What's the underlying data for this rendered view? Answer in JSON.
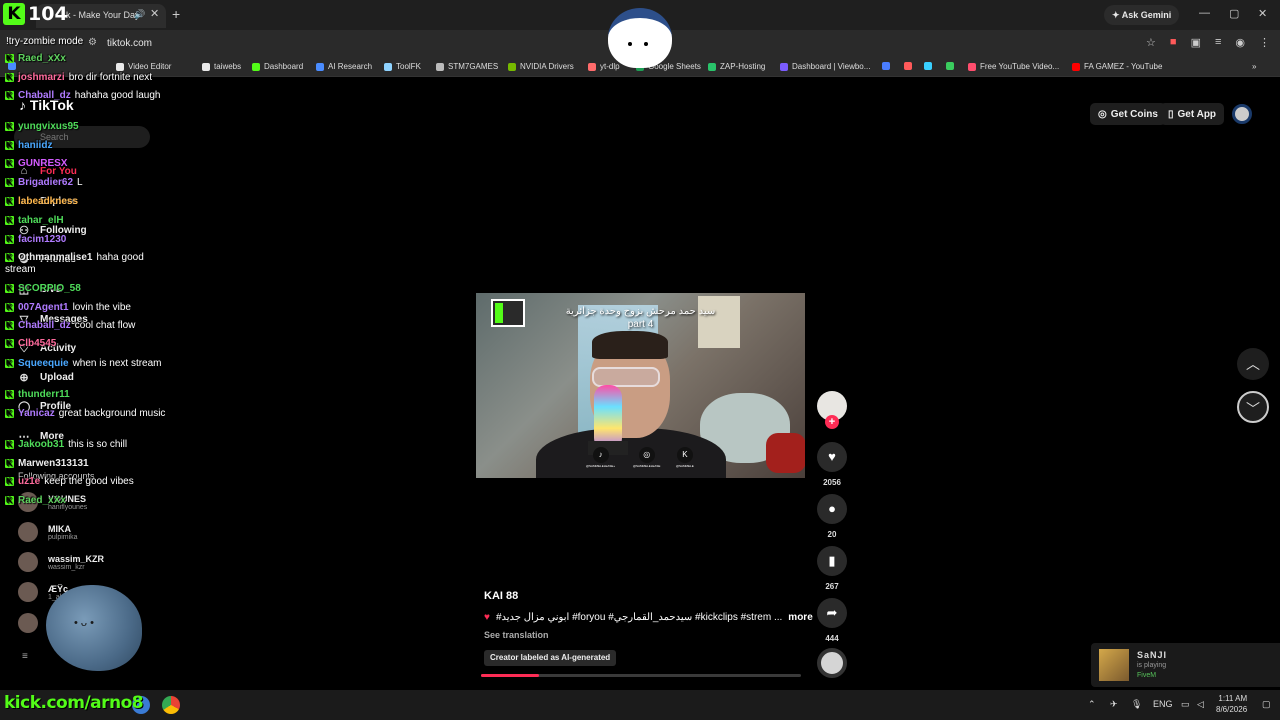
{
  "browser": {
    "tab_title": "k - Make Your Day",
    "new_tab": "+",
    "ask_gemini": "Ask Gemini",
    "url": "tiktok.com",
    "window_controls": [
      "—",
      "▢",
      "✕"
    ]
  },
  "stream_overlay": {
    "viewer_count": "104",
    "kick_logo": "K",
    "command_text": "!try-zombie mode",
    "kick_url": "kick.com/arno8"
  },
  "bookmarks": [
    {
      "label": "",
      "color": "#4a8cff"
    },
    {
      "label": "Video Editor",
      "color": "#e9e9e9"
    },
    {
      "label": "taiwebs",
      "color": "#e9e9e9"
    },
    {
      "label": "Dashboard",
      "color": "#53fc18"
    },
    {
      "label": "AI Research",
      "color": "#4a8cff"
    },
    {
      "label": "ToolFK",
      "color": "#8fd3ff"
    },
    {
      "label": "STM7GAMES",
      "color": "#bbbbbb"
    },
    {
      "label": "NVIDIA Drivers",
      "color": "#76b900"
    },
    {
      "label": "yt-dlp",
      "color": "#ff6b6b"
    },
    {
      "label": "Google Sheets",
      "color": "#1e9e55"
    },
    {
      "label": "ZAP-Hosting",
      "color": "#29c36a"
    },
    {
      "label": "Dashboard | Viewbo...",
      "color": "#7b5cff"
    },
    {
      "label": "",
      "color": "#4a7dff"
    },
    {
      "label": "",
      "color": "#ff5a5a"
    },
    {
      "label": "",
      "color": "#39d0ff"
    },
    {
      "label": "",
      "color": "#3acc5e"
    },
    {
      "label": "Free YouTube Video...",
      "color": "#ff4d6d"
    },
    {
      "label": "FA GAMEZ - YouTube",
      "color": "#ff0000"
    }
  ],
  "tiktok": {
    "logo": "TikTok",
    "search_placeholder": "Search",
    "nav": [
      "For You",
      "Explore",
      "Following",
      "Friends",
      "LIVE",
      "Messages",
      "Activity",
      "Upload",
      "Profile",
      "More"
    ],
    "following_title": "Following accounts",
    "following": [
      {
        "name": "YOUNES",
        "handle": "haniflyounes"
      },
      {
        "name": "MIKA",
        "handle": "pulpimika"
      },
      {
        "name": "wassim_KZR",
        "handle": "wassim_kzr"
      },
      {
        "name": "ÆŸç",
        "handle": "1_al"
      },
      {
        "name": "",
        "handle": ""
      }
    ],
    "get_coins": "Get Coins",
    "get_app": "Get App"
  },
  "chat": [
    {
      "user": "Raed_xXx",
      "text": "",
      "color": "#5fd35f"
    },
    {
      "user": "joshmarzi",
      "text": "bro dir fortnite next",
      "color": "#ff6b9d"
    },
    {
      "user": "Chaball_dz",
      "text": "hahaha good laugh",
      "color": "#b07bff"
    },
    {
      "user": "yungvixus95",
      "text": "",
      "color": "#4fdc5a"
    },
    {
      "user": "haniidz",
      "text": "",
      "color": "#4aa8ff"
    },
    {
      "user": "GUNRESX",
      "text": "",
      "color": "#d45cff"
    },
    {
      "user": "Brigadier62",
      "text": "L",
      "color": "#b07bff"
    },
    {
      "user": "labeadkness",
      "text": "",
      "color": "#ffb84d"
    },
    {
      "user": "tahar_elH",
      "text": "",
      "color": "#4fdc5a"
    },
    {
      "user": "facim1230",
      "text": "",
      "color": "#b07bff"
    },
    {
      "user": "Othmanmalise1",
      "text": "haha good stream",
      "color": "#eeeeee"
    },
    {
      "user": "SCORPIO_58",
      "text": "",
      "color": "#4fdc5a"
    },
    {
      "user": "007Agent1",
      "text": "lovin the vibe",
      "color": "#b07bff"
    },
    {
      "user": "Chaball_dz",
      "text": "cool chat flow",
      "color": "#b07bff"
    },
    {
      "user": "Clb4545",
      "text": "",
      "color": "#ff6b9d"
    },
    {
      "user": "Squeequie",
      "text": "when is next stream",
      "color": "#4aa8ff"
    },
    {
      "user": "thunderr11",
      "text": "",
      "color": "#4fdc5a"
    },
    {
      "user": "Yanicaz",
      "text": "great background music",
      "color": "#b07bff"
    },
    {
      "user": "Jakoob31",
      "text": "this is so chill",
      "color": "#4fdc5a"
    },
    {
      "user": "Marwen313131",
      "text": "",
      "color": "#eeeeee"
    },
    {
      "user": "uz1e",
      "text": "keep the good vibes",
      "color": "#ff6b9d"
    },
    {
      "user": "Raed_xXx",
      "text": "",
      "color": "#5fd35f"
    }
  ],
  "video": {
    "caption_line1": "سيد حمد مرحش بزوج وحدة جزائرية",
    "caption_line2": "part 4",
    "social": [
      {
        "icon": "♪",
        "label": "@SAMMELELEASE+"
      },
      {
        "icon": "◎",
        "label": "@SAMMELELEASE"
      },
      {
        "icon": "K",
        "label": "@SAMMELE"
      }
    ],
    "author": "KAI 88",
    "description": "#ابوني مزال جديد #foryou #سيدحمد_القمارجي #kickclips #strem ...",
    "more": "more",
    "see_translation": "See translation",
    "ai_label": "Creator labeled as AI-generated",
    "progress": 0.18
  },
  "actions": {
    "likes": "2056",
    "comments": "20",
    "saves": "267",
    "shares": "444"
  },
  "playing": {
    "name": "SaNJI",
    "status": "is playing",
    "game": "FiveM"
  },
  "taskbar": {
    "lang": "ENG",
    "time": "1:11 AM",
    "date": "8/6/2026"
  }
}
